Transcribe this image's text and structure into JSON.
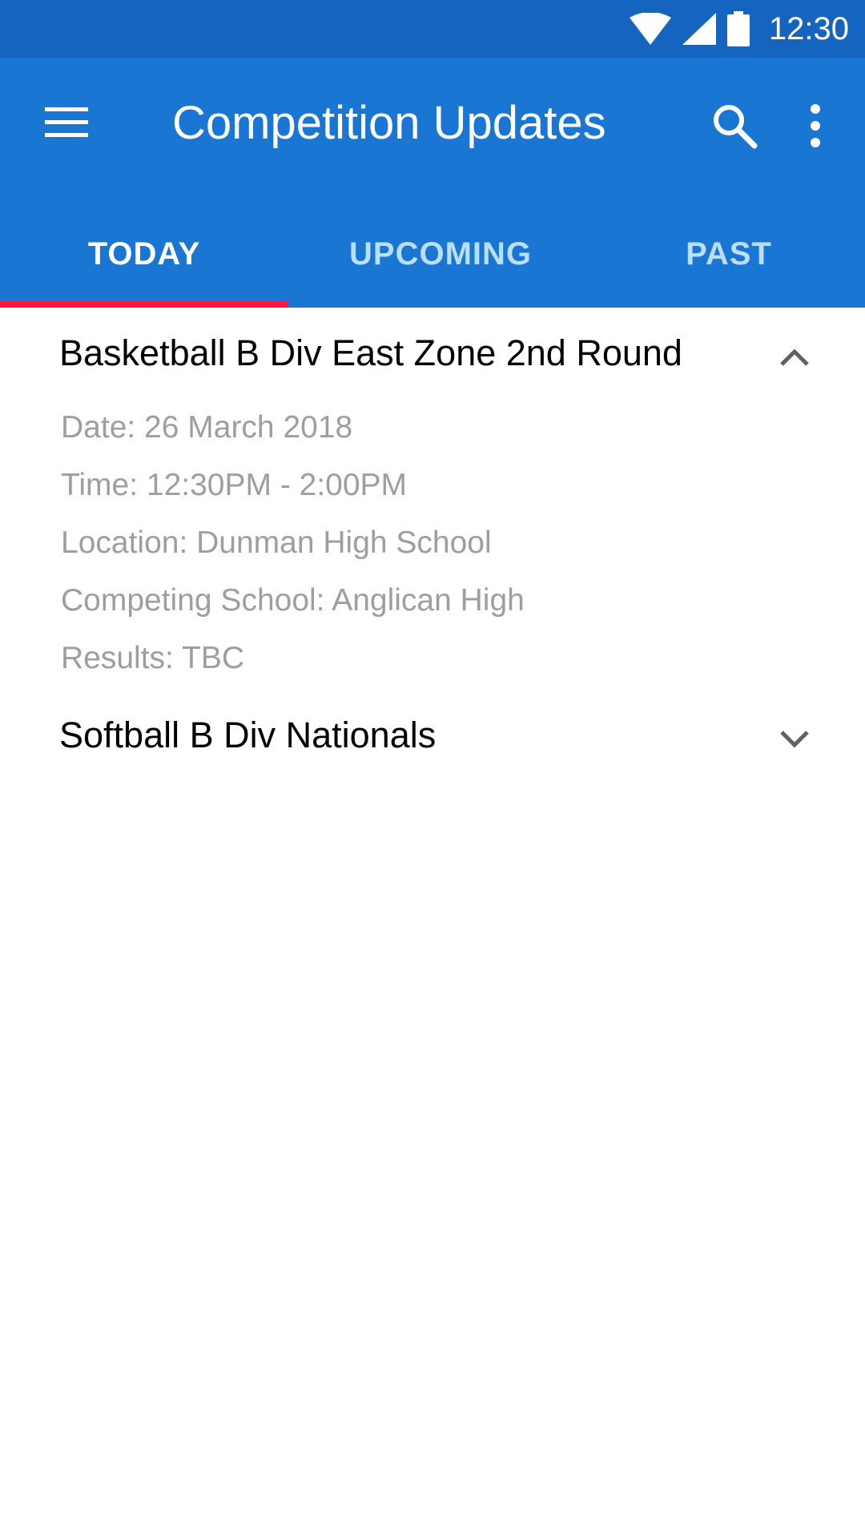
{
  "status_bar": {
    "time": "12:30",
    "icons": [
      "wifi-icon",
      "cell-signal-icon",
      "battery-icon"
    ]
  },
  "app_bar": {
    "title": "Competition Updates",
    "menu_icon": "menu-icon",
    "search_icon": "search-icon",
    "more_icon": "more-vert-icon"
  },
  "tabs": [
    {
      "label": "TODAY",
      "selected": true
    },
    {
      "label": "UPCOMING",
      "selected": false
    },
    {
      "label": "PAST",
      "selected": false
    }
  ],
  "items": [
    {
      "title": "Basketball B Div East Zone 2nd Round",
      "expanded": true,
      "details": [
        "Date: 26 March 2018",
        "Time: 12:30PM - 2:00PM",
        "Location: Dunman High School",
        "Competing School: Anglican High",
        "Results: TBC"
      ]
    },
    {
      "title": "Softball B Div Nationals",
      "expanded": false,
      "details": []
    }
  ],
  "colors": {
    "status_bar": "#1565C0",
    "app_bar": "#1976D2",
    "tab_indicator": "#FF1744",
    "detail_text": "#9E9E9E"
  }
}
